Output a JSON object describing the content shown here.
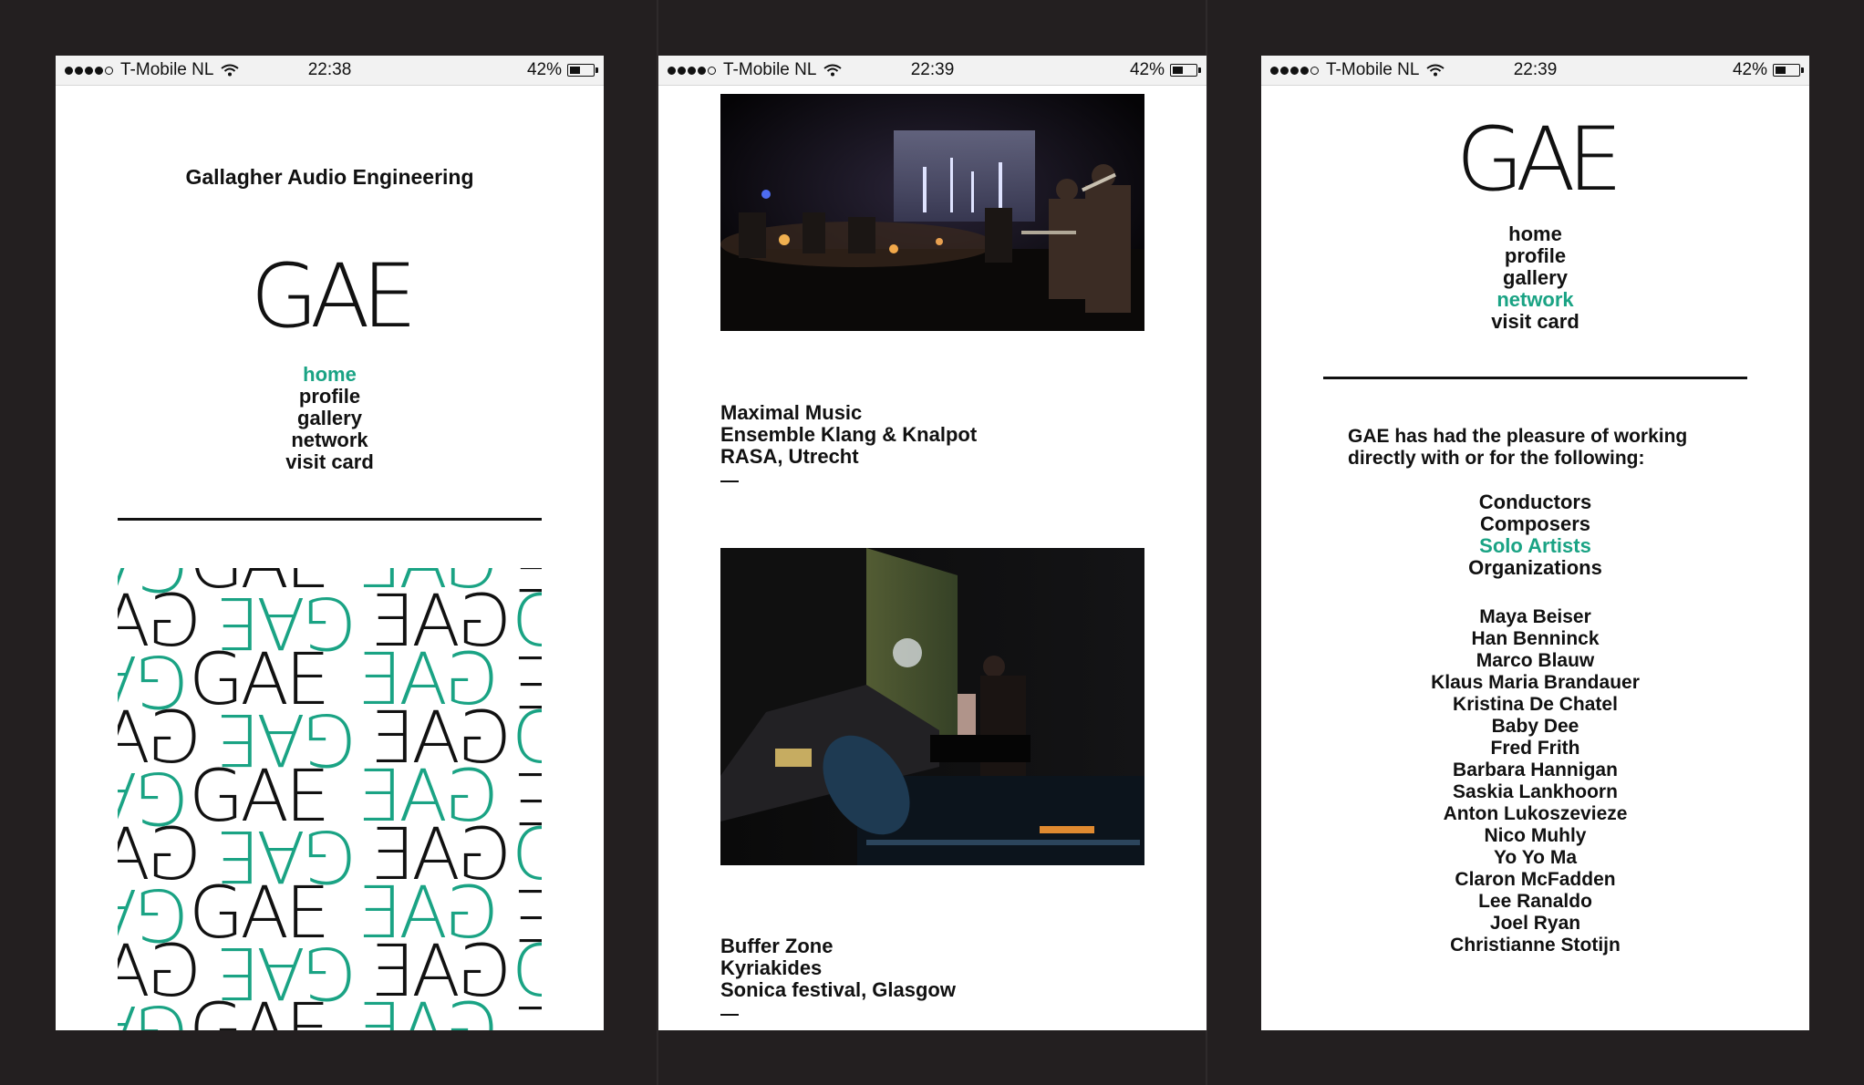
{
  "status": {
    "carrier": "T-Mobile NL",
    "battery": "42%",
    "battery_level": 0.42,
    "screens": [
      {
        "time": "22:38"
      },
      {
        "time": "22:39"
      },
      {
        "time": "22:39"
      }
    ]
  },
  "brand": {
    "title": "Gallagher Audio Engineering",
    "logo": "GAE"
  },
  "colors": {
    "accent": "#1aa384",
    "text": "#111111",
    "frame": "#231f20"
  },
  "nav": {
    "items": [
      "home",
      "profile",
      "gallery",
      "network",
      "visit card"
    ]
  },
  "screen1": {
    "active_nav": "home"
  },
  "screen3": {
    "active_nav": "network"
  },
  "pattern": {
    "text": "GAE"
  },
  "gallery": {
    "entries": [
      {
        "image": "photo of an ensemble performing on a dark stage with projection screen",
        "lines": [
          "Maximal Music",
          "Ensemble Klang & Knalpot",
          "RASA, Utrecht"
        ]
      },
      {
        "image": "photo of a conductor at a piano on a dim stage with mixing desk in foreground",
        "lines": [
          "Buffer Zone",
          "Kyriakides",
          "Sonica festival, Glasgow"
        ]
      }
    ]
  },
  "network": {
    "intro": "GAE has had the pleasure of working directly with or for the following:",
    "categories": [
      "Conductors",
      "Composers",
      "Solo Artists",
      "Organizations"
    ],
    "active_category": "Solo Artists",
    "names": [
      "Maya Beiser",
      "Han Benninck",
      "Marco Blauw",
      "Klaus Maria Brandauer",
      "Kristina De Chatel",
      "Baby Dee",
      "Fred Frith",
      "Barbara Hannigan",
      "Saskia Lankhoorn",
      "Anton Lukoszevieze",
      "Nico Muhly",
      "Yo Yo Ma",
      "Claron McFadden",
      "Lee Ranaldo",
      "Joel Ryan",
      "Christianne Stotijn"
    ]
  }
}
